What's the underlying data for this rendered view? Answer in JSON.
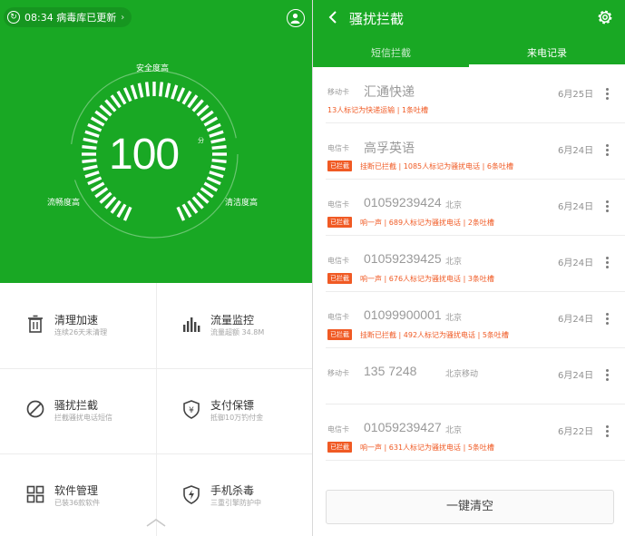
{
  "left": {
    "status_time_text": "08:34 病毒库已更新",
    "hero": {
      "score": "100",
      "score_unit": "分",
      "label_safe": "安全度高",
      "label_smooth": "流畅度高",
      "label_clean": "清洁度高"
    },
    "tiles": [
      {
        "title": "清理加速",
        "subtitle": "连续26天未清理",
        "icon": "trash-icon"
      },
      {
        "title": "流量监控",
        "subtitle": "流量超额 34.8M",
        "icon": "bar-chart-icon"
      },
      {
        "title": "骚扰拦截",
        "subtitle": "拦截骚扰电话短信",
        "icon": "block-icon"
      },
      {
        "title": "支付保镖",
        "subtitle": "抵御10万钓付金",
        "icon": "shield-yuan-icon"
      },
      {
        "title": "软件管理",
        "subtitle": "已装36款软件",
        "icon": "apps-grid-icon"
      },
      {
        "title": "手机杀毒",
        "subtitle": "三重引擎防护中",
        "icon": "shield-bolt-icon"
      }
    ],
    "colors": {
      "brand_green": "#19a824"
    }
  },
  "right": {
    "title": "骚扰拦截",
    "tabs": [
      {
        "label": "短信拦截",
        "active": false
      },
      {
        "label": "来电记录",
        "active": true
      }
    ],
    "calls": [
      {
        "sim": "移动卡",
        "number": "汇通快递",
        "location": "",
        "date": "6月25日",
        "badge": "",
        "desc": "13人标记为快递运输 | 1条吐槽"
      },
      {
        "sim": "电信卡",
        "number": "高孚英语",
        "location": "",
        "date": "6月24日",
        "badge": "已拦截",
        "desc": "挂断已拦截 | 1085人标记为骚扰电话 | 6条吐槽"
      },
      {
        "sim": "电信卡",
        "number": "01059239424",
        "location": "北京",
        "date": "6月24日",
        "badge": "已拦截",
        "desc": "响一声 | 689人标记为骚扰电话 | 2条吐槽"
      },
      {
        "sim": "电信卡",
        "number": "01059239425",
        "location": "北京",
        "date": "6月24日",
        "badge": "已拦截",
        "desc": "响一声 | 676人标记为骚扰电话 | 3条吐槽"
      },
      {
        "sim": "电信卡",
        "number": "01099900001",
        "location": "北京",
        "date": "6月24日",
        "badge": "已拦截",
        "desc": "挂断已拦截 | 492人标记为骚扰电话 | 5条吐槽"
      },
      {
        "sim": "移动卡",
        "number": "135 7248",
        "location": "北京移动",
        "date": "6月24日",
        "badge": "",
        "desc": ""
      },
      {
        "sim": "电信卡",
        "number": "01059239427",
        "location": "北京",
        "date": "6月22日",
        "badge": "已拦截",
        "desc": "响一声 | 631人标记为骚扰电话 | 5条吐槽"
      }
    ],
    "clear_button": "一键清空"
  }
}
